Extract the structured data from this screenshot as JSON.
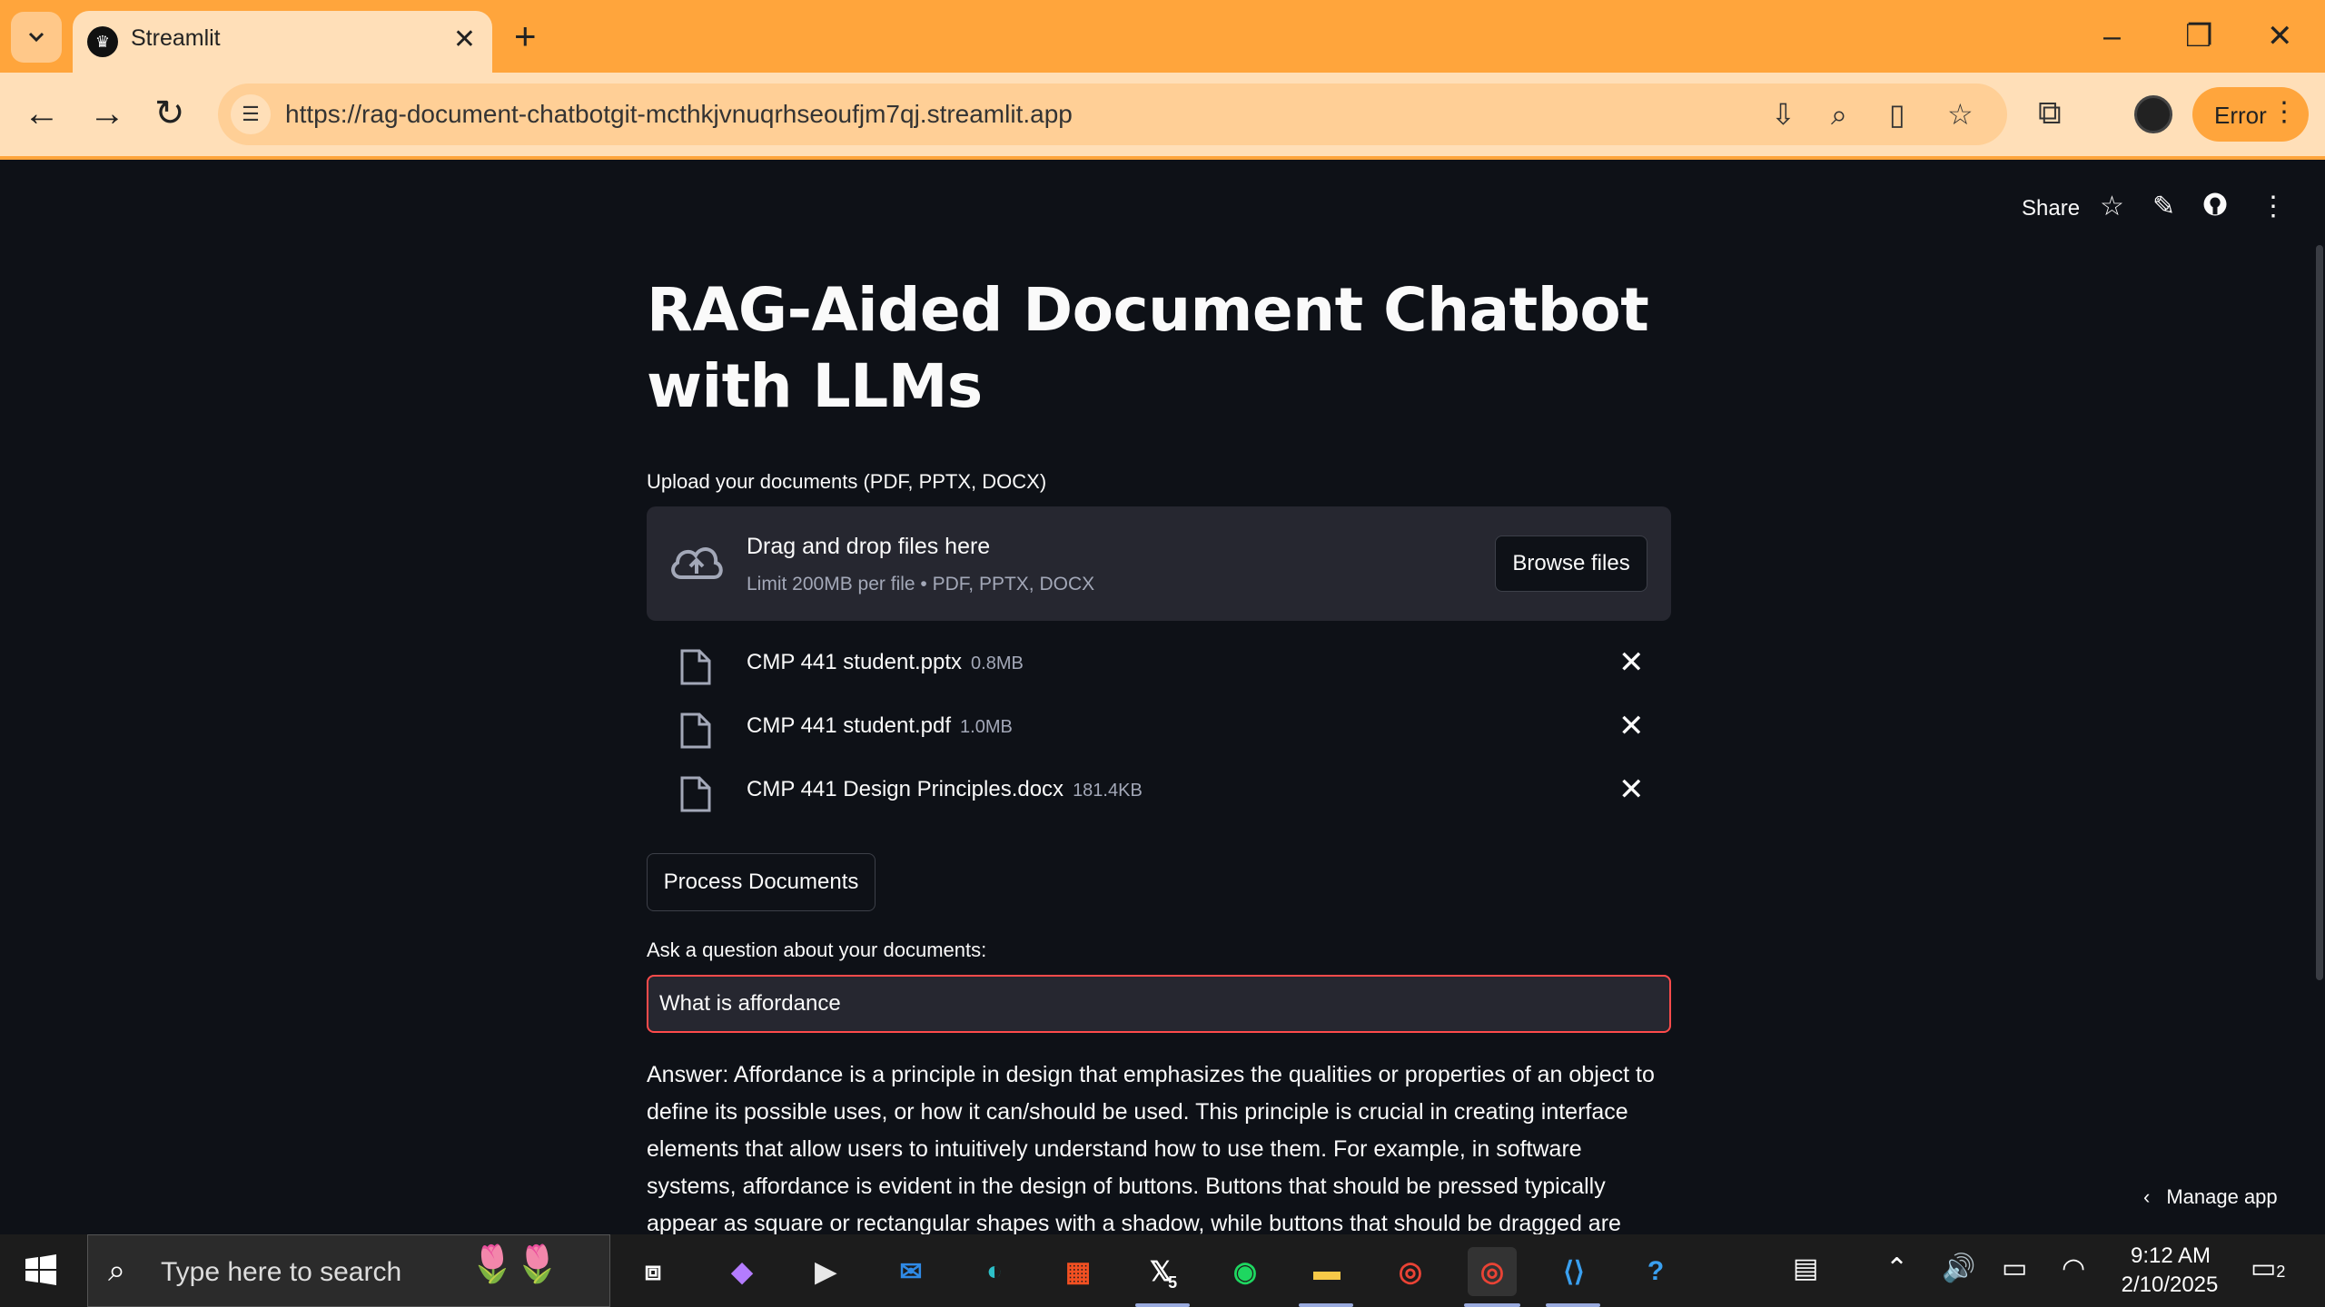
{
  "browser": {
    "tab_title": "Streamlit",
    "url": "https://rag-document-chatbotgit-mcthkjvnuqrhseoufjm7qj.streamlit.app",
    "profile_status": "Error"
  },
  "app_header": {
    "share_label": "Share"
  },
  "main": {
    "title": "RAG-Aided Document Chatbot with LLMs",
    "uploader_label": "Upload your documents (PDF, PPTX, DOCX)",
    "dropzone_title": "Drag and drop files here",
    "dropzone_limit": "Limit 200MB per file • PDF, PPTX, DOCX",
    "browse_label": "Browse files",
    "files": [
      {
        "name": "CMP 441 student.pptx",
        "size": "0.8MB"
      },
      {
        "name": "CMP 441 student.pdf",
        "size": "1.0MB"
      },
      {
        "name": "CMP 441 Design Principles.docx",
        "size": "181.4KB"
      }
    ],
    "process_label": "Process Documents",
    "question_label": "Ask a question about your documents:",
    "question_value": "What is affordance",
    "answer_text": "Answer: Affordance is a principle in design that emphasizes the qualities or properties of an object to define its possible uses, or how it can/should be used. This principle is crucial in creating interface elements that allow users to intuitively understand how to use them. For example, in software systems, affordance is evident in the design of buttons. Buttons that should be pressed typically appear as square or rectangular shapes with a shadow, while buttons that should be dragged are typically flat."
  },
  "manage_app_label": "Manage app",
  "taskbar": {
    "search_placeholder": "Type here to search",
    "x_badge": "5",
    "time": "9:12 AM",
    "date": "2/10/2025",
    "notification_count": "2"
  },
  "colors": {
    "chrome_accent": "#ffa53c",
    "app_bg": "#0e1117",
    "input_focus": "#ff4b4b"
  }
}
